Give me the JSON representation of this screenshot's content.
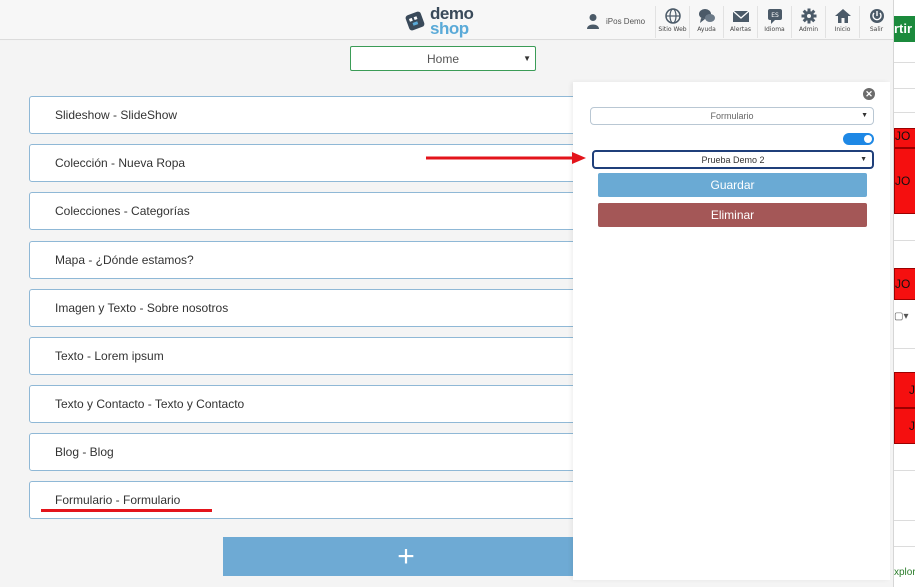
{
  "logo": {
    "line1": "demo",
    "line2": "shop"
  },
  "user": {
    "name": "iPos Demo",
    "icon": "user-icon"
  },
  "nav": [
    {
      "label": "Sitio Web",
      "icon": "globe-icon"
    },
    {
      "label": "Ayuda",
      "icon": "help-chat-icon"
    },
    {
      "label": "Alertas",
      "icon": "mail-icon"
    },
    {
      "label": "Idioma",
      "icon": "language-icon",
      "badge": "ES"
    },
    {
      "label": "Admin",
      "icon": "gear-icon"
    },
    {
      "label": "Inicio",
      "icon": "home-icon"
    },
    {
      "label": "Salir",
      "icon": "power-icon"
    }
  ],
  "page_select": {
    "value": "Home"
  },
  "sections": [
    "Slideshow - SlideShow",
    "Colección - Nueva Ropa",
    "Colecciones - Categorías",
    "Mapa - ¿Dónde estamos?",
    "Imagen y Texto - Sobre nosotros",
    "Texto - Lorem ipsum",
    "Texto y Contacto - Texto y Contacto",
    "Blog - Blog",
    "Formulario - Formulario"
  ],
  "add_button": {
    "label": "+"
  },
  "panel": {
    "type_select": "Formulario",
    "toggle_on": true,
    "form_select": "Prueba Demo 2",
    "save_label": "Guardar",
    "delete_label": "Eliminar"
  },
  "background_window": {
    "button": "rtir",
    "red_cells": [
      "JO",
      "JO",
      "JO",
      "J",
      "J"
    ],
    "footer": "xplora"
  },
  "colors": {
    "section_border": "#8fb8d6",
    "save": "#6aaad4",
    "delete": "#a45757",
    "annotation_red": "#e3141b",
    "page_select_border": "#3b9c57"
  }
}
